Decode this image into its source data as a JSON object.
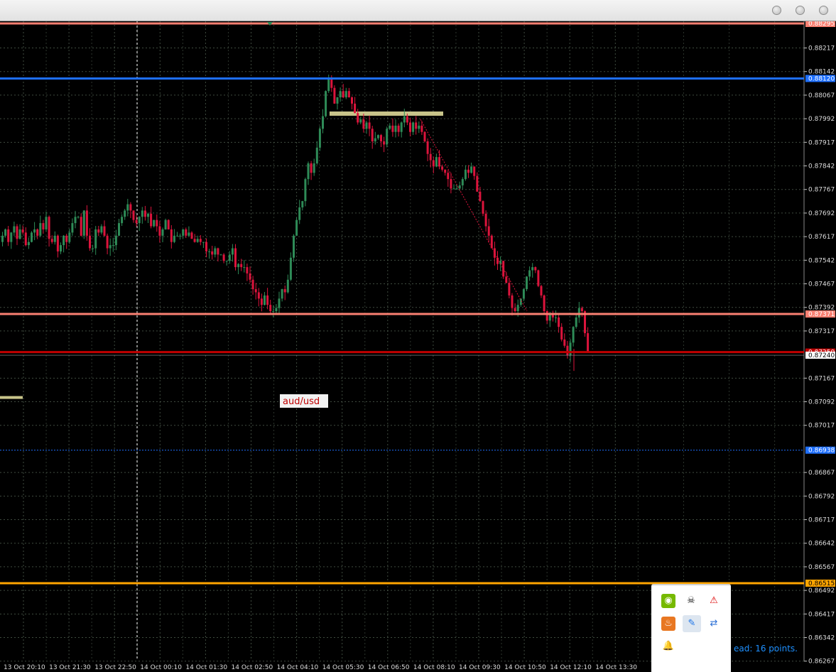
{
  "window": {
    "buttons": [
      "minimize",
      "zoom",
      "close"
    ]
  },
  "chart_data": {
    "type": "candlestick",
    "symbol_label": "aud/usd",
    "y_ticks": [
      "0.88217",
      "0.88142",
      "0.88067",
      "0.87992",
      "0.87917",
      "0.87842",
      "0.87767",
      "0.87692",
      "0.87617",
      "0.87542",
      "0.87467",
      "0.87392",
      "0.87317",
      "0.87167",
      "0.87092",
      "0.87017",
      "0.86867",
      "0.86792",
      "0.86717",
      "0.86642",
      "0.86567",
      "0.86492",
      "0.86417",
      "0.86342",
      "0.86267"
    ],
    "x_ticks": [
      "13 Oct 20:10",
      "13 Oct 21:30",
      "13 Oct 22:50",
      "14 Oct 00:10",
      "14 Oct 01:30",
      "14 Oct 02:50",
      "14 Oct 04:10",
      "14 Oct 05:30",
      "14 Oct 06:50",
      "14 Oct 08:10",
      "14 Oct 09:30",
      "14 Oct 10:50",
      "14 Oct 12:10",
      "14 Oct 13:30"
    ],
    "ylim": [
      0.8625,
      0.883
    ],
    "grid": true,
    "levels": [
      {
        "price": 0.88295,
        "label": "0.88295",
        "color": "#fa8072",
        "style": "solid"
      },
      {
        "price": 0.8812,
        "label": "0.88120",
        "color": "#1e6fff",
        "style": "solid"
      },
      {
        "price": 0.87371,
        "label": "0.87371",
        "color": "#fa8072",
        "style": "solid"
      },
      {
        "price": 0.8725,
        "label": "0.87250",
        "color": "#c00000",
        "style": "solid"
      },
      {
        "price": 0.8724,
        "label": "0.87240",
        "color": "#ffffff",
        "style": "bid"
      },
      {
        "price": 0.86938,
        "label": "0.86938",
        "color": "#1e6fff",
        "style": "dashed"
      },
      {
        "price": 0.86515,
        "label": "0.86515",
        "color": "#ffa500",
        "style": "solid"
      }
    ],
    "zones": [
      {
        "price_top": 0.88015,
        "price_bottom": 0.88,
        "color": "#c8c48a"
      },
      {
        "price_top": 0.8711,
        "price_bottom": 0.871,
        "color": "#c8c48a"
      }
    ],
    "close_series": [
      0.8762,
      0.8764,
      0.876,
      0.8763,
      0.8765,
      0.8761,
      0.8764,
      0.8763,
      0.8759,
      0.876,
      0.8763,
      0.8764,
      0.8762,
      0.8766,
      0.8764,
      0.8768,
      0.8761,
      0.876,
      0.8762,
      0.8757,
      0.8759,
      0.8762,
      0.876,
      0.8763,
      0.8766,
      0.8768,
      0.8768,
      0.8762,
      0.877,
      0.8762,
      0.8758,
      0.8758,
      0.8764,
      0.8763,
      0.8765,
      0.8762,
      0.8758,
      0.8759,
      0.8759,
      0.8762,
      0.8766,
      0.8768,
      0.877,
      0.8772,
      0.877,
      0.8767,
      0.8766,
      0.8768,
      0.877,
      0.8768,
      0.8769,
      0.8765,
      0.8767,
      0.8765,
      0.8762,
      0.8764,
      0.8767,
      0.8764,
      0.876,
      0.8762,
      0.8762,
      0.8762,
      0.8764,
      0.8762,
      0.8763,
      0.8761,
      0.876,
      0.8761,
      0.876,
      0.876,
      0.8757,
      0.8757,
      0.8756,
      0.8758,
      0.8756,
      0.8756,
      0.8754,
      0.8754,
      0.8756,
      0.8758,
      0.8752,
      0.8753,
      0.8752,
      0.8752,
      0.875,
      0.8748,
      0.8745,
      0.8744,
      0.8742,
      0.874,
      0.8743,
      0.874,
      0.8738,
      0.8738,
      0.8739,
      0.8742,
      0.8745,
      0.8744,
      0.8748,
      0.8755,
      0.8762,
      0.8767,
      0.8771,
      0.8773,
      0.878,
      0.8785,
      0.8782,
      0.8785,
      0.879,
      0.8796,
      0.88,
      0.8808,
      0.8812,
      0.8809,
      0.8804,
      0.8806,
      0.8808,
      0.8806,
      0.8808,
      0.8806,
      0.8804,
      0.8801,
      0.8798,
      0.8799,
      0.8796,
      0.8798,
      0.8796,
      0.8792,
      0.8793,
      0.8794,
      0.8792,
      0.8791,
      0.8796,
      0.8797,
      0.8795,
      0.8797,
      0.8795,
      0.8798,
      0.88,
      0.8798,
      0.8795,
      0.8798,
      0.8796,
      0.8797,
      0.8795,
      0.8792,
      0.8788,
      0.8786,
      0.8784,
      0.8787,
      0.8784,
      0.8783,
      0.8782,
      0.878,
      0.8777,
      0.8777,
      0.8777,
      0.8778,
      0.878,
      0.8783,
      0.8782,
      0.8784,
      0.8781,
      0.8776,
      0.8773,
      0.8769,
      0.8765,
      0.8762,
      0.8758,
      0.8755,
      0.8753,
      0.8754,
      0.8749,
      0.8747,
      0.8743,
      0.8739,
      0.8738,
      0.874,
      0.8742,
      0.8745,
      0.8749,
      0.8751,
      0.8752,
      0.8751,
      0.8746,
      0.8743,
      0.8738,
      0.8735,
      0.8737,
      0.8736,
      0.8736,
      0.8733,
      0.8729,
      0.8727,
      0.8724,
      0.8728,
      0.8733,
      0.8736,
      0.8739,
      0.8738,
      0.8731,
      0.8725
    ]
  },
  "tray": {
    "icons": [
      "nvidia-icon",
      "pirate-icon",
      "warning-icon",
      "java-icon",
      "pen-icon",
      "network-icon",
      "bell-icon"
    ],
    "spread_text": "ead: 16 points."
  }
}
